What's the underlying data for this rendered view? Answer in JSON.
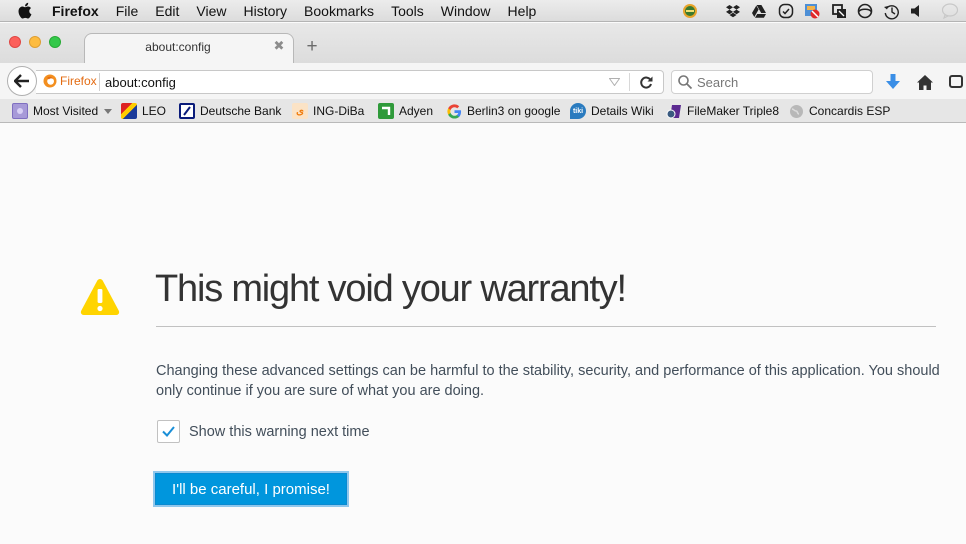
{
  "menubar": {
    "app_name": "Firefox",
    "items": [
      "File",
      "Edit",
      "View",
      "History",
      "Bookmarks",
      "Tools",
      "Window",
      "Help"
    ],
    "status_icons": [
      "app-badge-icon",
      "dropbox-icon",
      "google-drive-icon",
      "checklist-icon",
      "blocked-app-icon",
      "window-overlap-icon",
      "sync-status-icon",
      "time-machine-icon",
      "volume-icon",
      "chat-bubble-icon"
    ]
  },
  "window": {
    "traffic_lights": {
      "close": "#fc605b",
      "minimize": "#fdbc40",
      "zoom": "#34c84a"
    }
  },
  "tabs": [
    {
      "title": "about:config",
      "active": true
    }
  ],
  "new_tab_symbol": "+",
  "tab_close_symbol": "✖",
  "navbar": {
    "identity_label": "Firefox",
    "url": "about:config",
    "search_placeholder": "Search",
    "accent_color": "#e36b12",
    "download_color": "#3a8ee6"
  },
  "bookmarks": [
    {
      "label": "Most Visited",
      "icon": "folder-icon",
      "dropdown": true
    },
    {
      "label": "LEO",
      "icon": "leo-icon"
    },
    {
      "label": "Deutsche Bank",
      "icon": "deutsche-bank-icon"
    },
    {
      "label": "ING-DiBa",
      "icon": "ing-lion-icon"
    },
    {
      "label": "Adyen",
      "icon": "adyen-icon"
    },
    {
      "label": "Berlin3 on google",
      "icon": "google-icon"
    },
    {
      "label": "Details Wiki",
      "icon": "tiki-icon"
    },
    {
      "label": "FileMaker Triple8",
      "icon": "filemaker-icon"
    },
    {
      "label": "Concardis ESP",
      "icon": "globe-icon"
    }
  ],
  "content": {
    "title": "This might void your warranty!",
    "description": "Changing these advanced settings can be harmful to the stability, security, and performance of this application. You should only continue if you are sure of what you are doing.",
    "checkbox_label": "Show this warning next time",
    "checkbox_checked": true,
    "button_label": "I'll be careful, I promise!",
    "warning_color": "#ffd400",
    "button_color": "#0096dd"
  }
}
